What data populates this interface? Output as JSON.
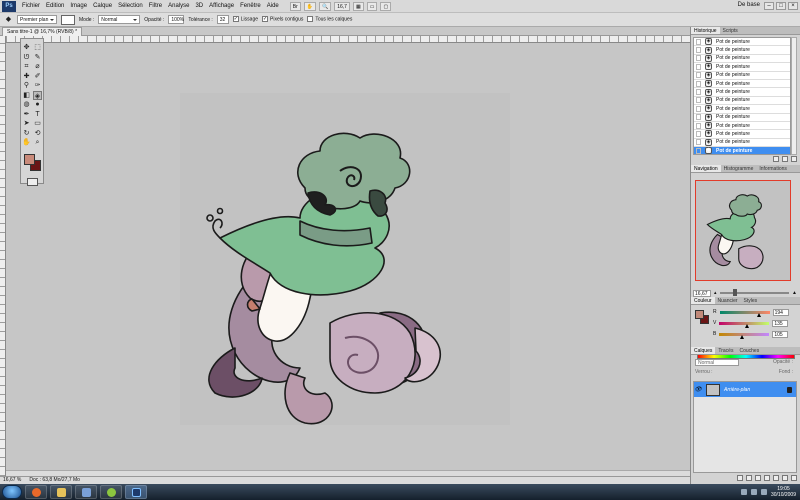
{
  "app": {
    "logo": "Ps",
    "zoom": "16,7",
    "workspace": "De base"
  },
  "menu": [
    "Fichier",
    "Edition",
    "Image",
    "Calque",
    "Sélection",
    "Filtre",
    "Analyse",
    "3D",
    "Affichage",
    "Fenêtre",
    "Aide"
  ],
  "options": {
    "preset": "Premier plan",
    "mode_label": "Mode :",
    "mode_value": "Normal",
    "opacity_label": "Opacité :",
    "opacity_value": "100%",
    "tolerance_label": "Tolérance :",
    "tolerance_value": "32",
    "antialias": "Lissage",
    "contiguous": "Pixels contigus",
    "all_layers": "Tous les calques"
  },
  "document": {
    "tab": "Sans titre-1 @ 16,7% (RVB/8) *",
    "zoom": "16,67 %",
    "doc_size": "Doc : 63,8 Mo/27,7 Mo"
  },
  "history": {
    "tabs": [
      "Historique",
      "Scripts"
    ],
    "items": [
      "Pot de peinture",
      "Pot de peinture",
      "Pot de peinture",
      "Pot de peinture",
      "Pot de peinture",
      "Pot de peinture",
      "Pot de peinture",
      "Pot de peinture",
      "Pot de peinture",
      "Pot de peinture",
      "Pot de peinture",
      "Pot de peinture",
      "Pot de peinture",
      "Pot de peinture"
    ],
    "selected_index": 13
  },
  "navigator": {
    "tabs": [
      "Navigation",
      "Histogramme",
      "Informations"
    ],
    "zoom": "16,67 %"
  },
  "color": {
    "tabs": [
      "Couleur",
      "Nuancier",
      "Styles"
    ],
    "r_label": "R",
    "g_label": "V",
    "b_label": "B",
    "r": "194",
    "g": "135",
    "b": "105",
    "fg": "#c18979",
    "bg": "#6a1515"
  },
  "layers": {
    "tabs": [
      "Calques",
      "Tracés",
      "Couches"
    ],
    "blend": "Normal",
    "opacity_label": "Opacité :",
    "lock_label": "Verrou :",
    "fill_label": "Fond :",
    "layer_name": "Arrière-plan"
  },
  "taskbar": {
    "time": "19:05",
    "date": "30/10/2009"
  }
}
